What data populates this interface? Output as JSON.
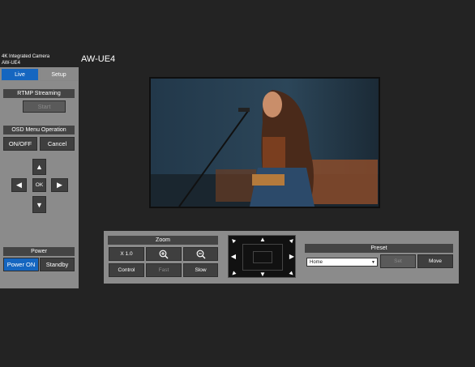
{
  "header": {
    "product_line": "4K Integrated Camera",
    "model_small": "AW-UE4",
    "model_title": "AW-UE4"
  },
  "tabs": {
    "live": "Live",
    "setup": "Setup"
  },
  "rtmp": {
    "header": "RTMP Streaming",
    "start": "Start"
  },
  "osd": {
    "header": "OSD Menu Operation",
    "onoff": "ON/OFF",
    "cancel": "Cancel",
    "ok": "OK"
  },
  "power": {
    "header": "Power",
    "on": "Power ON",
    "standby": "Standby"
  },
  "zoom": {
    "header": "Zoom",
    "level": "X 1.0",
    "control": "Control",
    "fast": "Fast",
    "slow": "Slow"
  },
  "preset": {
    "header": "Preset",
    "selected": "Home",
    "set": "Set",
    "move": "Move"
  },
  "colors": {
    "accent": "#1566c0",
    "panel": "#8b8b8b",
    "background": "#232323"
  }
}
